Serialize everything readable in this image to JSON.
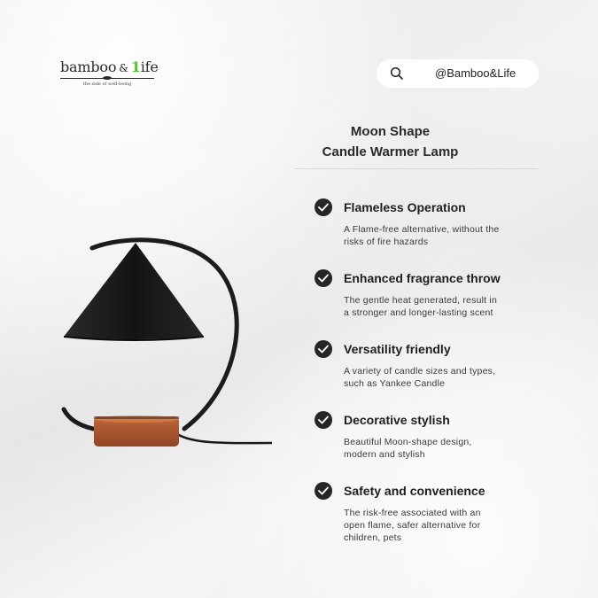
{
  "logo": {
    "word_part1": "bamboo",
    "amp": "&",
    "accent": "1",
    "word_part2": "ife",
    "tagline": "the side of well-being"
  },
  "search": {
    "icon": "search-icon",
    "handle": "@Bamboo&Life"
  },
  "product": {
    "title_line1": "Moon Shape",
    "title_line2": "Candle Warmer Lamp"
  },
  "features": [
    {
      "icon": "check-circle-icon",
      "title": "Flameless Operation",
      "desc_line1": "A Flame-free alternative, without the",
      "desc_line2": "risks of fire hazards",
      "desc_line3": ""
    },
    {
      "icon": "check-circle-icon",
      "title": "Enhanced fragrance throw",
      "desc_line1": "The gentle heat generated, result in",
      "desc_line2": "a stronger and longer-lasting scent",
      "desc_line3": ""
    },
    {
      "icon": "check-circle-icon",
      "title": "Versatility friendly",
      "desc_line1": "A variety of candle sizes and types,",
      "desc_line2": "such as Yankee Candle",
      "desc_line3": ""
    },
    {
      "icon": "check-circle-icon",
      "title": "Decorative stylish",
      "desc_line1": "Beautiful Moon-shape design,",
      "desc_line2": "modern and stylish",
      "desc_line3": ""
    },
    {
      "icon": "check-circle-icon",
      "title": "Safety and convenience",
      "desc_line1": "The risk-free associated with an",
      "desc_line2": "open flame,  safer alternative for",
      "desc_line3": "children, pets"
    }
  ],
  "colors": {
    "accent_green": "#5ebf3c",
    "lamp_black": "#1c1c1c",
    "wood_base": "#a4522d"
  }
}
